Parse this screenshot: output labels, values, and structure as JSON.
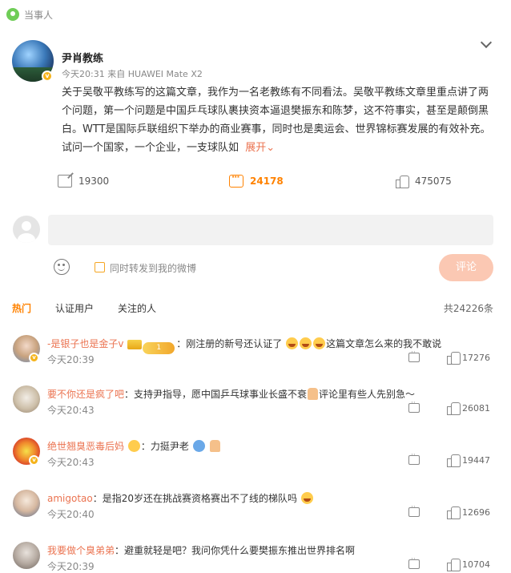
{
  "header": {
    "label": "当事人"
  },
  "post": {
    "author": "尹肖教练",
    "meta": "今天20:31  来自 HUAWEI Mate X2",
    "body": "关于吴敬平教练写的这篇文章，我作为一名老教练有不同看法。吴敬平教练文章里重点讲了两个问题，第一个问题是中国乒乓球队裹挟资本逼退樊振东和陈梦，这不符事实，甚至是颠倒黑白。WTT是国际乒联组织下举办的商业赛事，同时也是奥运会、世界锦标赛发展的有效补充。试问一个国家，一个企业，一支球队如",
    "expand_label": "展开",
    "shares": "19300",
    "comments": "24178",
    "likes": "475075"
  },
  "composer": {
    "input_value": "",
    "repost_label": "同时转发到我的微博",
    "submit_label": "评论"
  },
  "tabs": [
    {
      "label": "热门"
    },
    {
      "label": "认证用户"
    },
    {
      "label": "关注的人"
    }
  ],
  "total": "共24226条",
  "comments": [
    {
      "user": "-是银子也是金子v",
      "text": "：刚注册的新号还认证了",
      "text2": "这篇文章怎么来的我不敢说",
      "time": "今天20:39",
      "likes": "17276",
      "vip_label": "1"
    },
    {
      "user": "要不你还是疯了吧",
      "text": "：支持尹指导，愿中国乒乓球事业长盛不衰",
      "text2": "评论里有些人先别急～",
      "time": "今天20:43",
      "likes": "26081"
    },
    {
      "user": "绝世翘臭恶毒后妈",
      "text": "：力挺尹老",
      "time": "今天20:43",
      "likes": "19447"
    },
    {
      "user": "amigotao",
      "text": "：是指20岁还在挑战赛资格赛出不了线的梯队吗",
      "time": "今天20:40",
      "likes": "12696"
    },
    {
      "user": "我要做个臭弟弟",
      "text": "：避重就轻是吧？我问你凭什么要樊振东推出世界排名啊",
      "time": "今天20:39",
      "likes": "10704"
    }
  ],
  "colors": {
    "accent": "#ff8200",
    "username": "#eb7350",
    "submit": "#fbc8b3"
  }
}
